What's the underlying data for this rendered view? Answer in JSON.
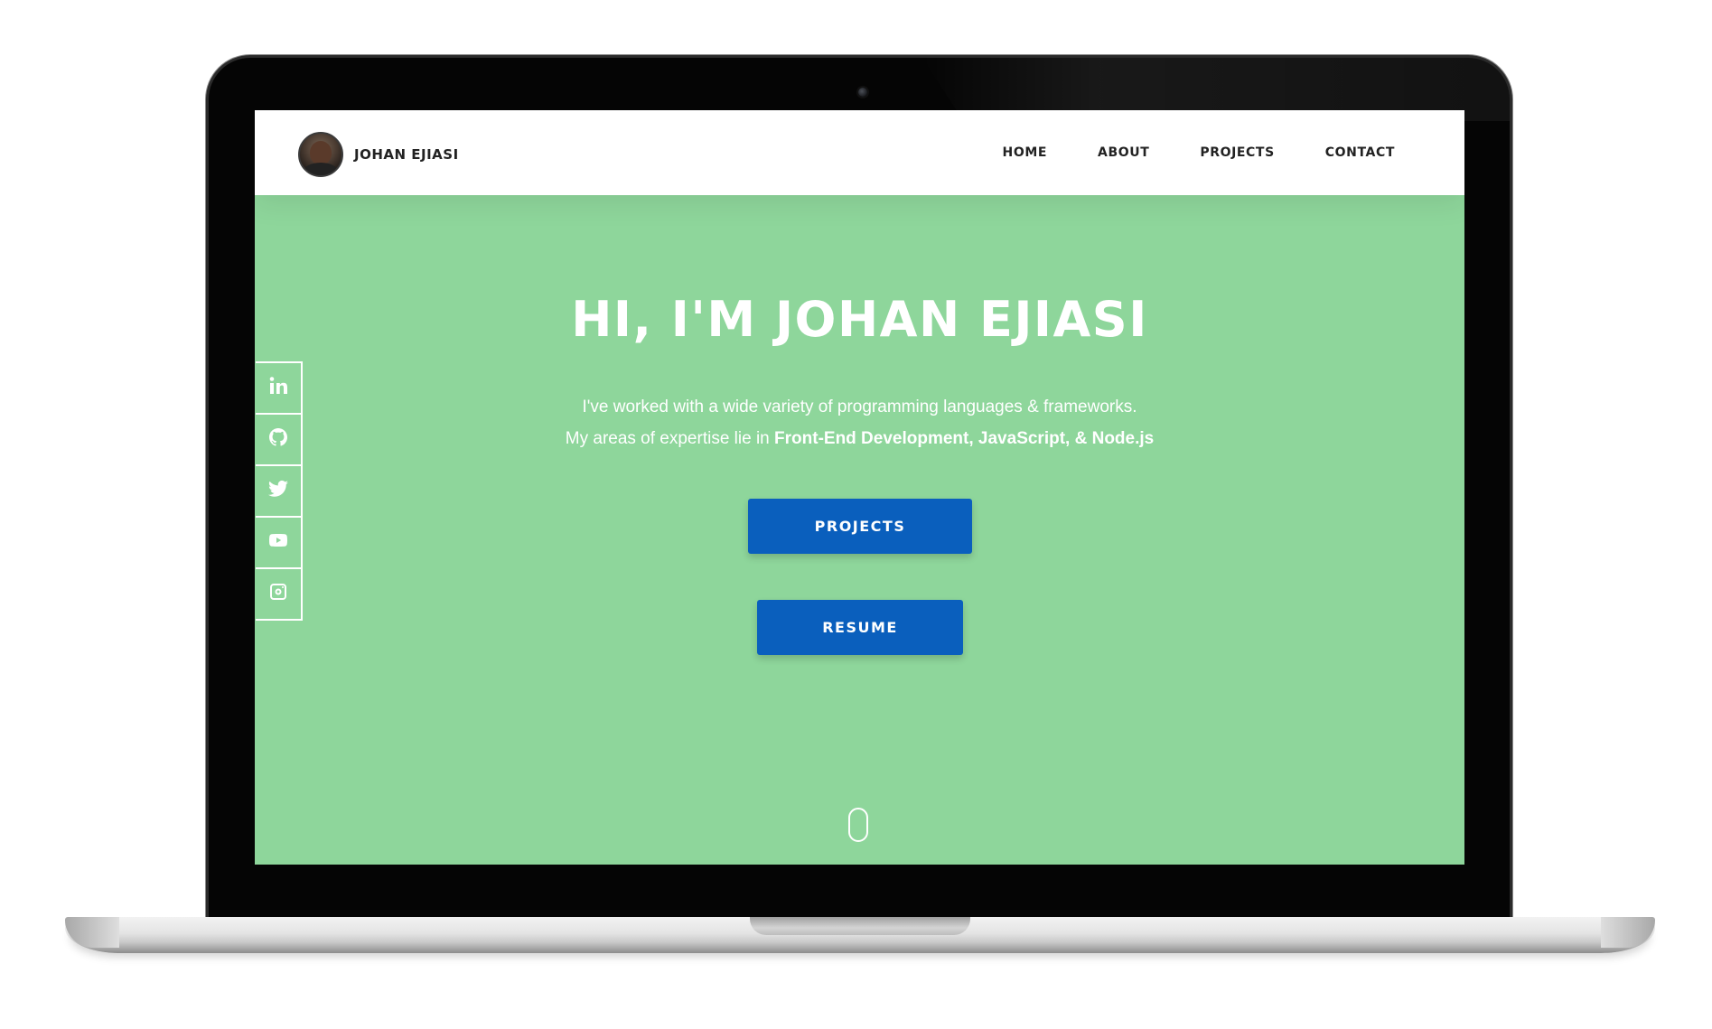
{
  "brand": {
    "name": "JOHAN EJIASI"
  },
  "nav": {
    "items": [
      {
        "label": "HOME"
      },
      {
        "label": "ABOUT"
      },
      {
        "label": "PROJECTS"
      },
      {
        "label": "CONTACT"
      }
    ]
  },
  "hero": {
    "title": "HI, I'M JOHAN EJIASI",
    "line1": "I've worked with a wide variety of programming languages & frameworks.",
    "line2_prefix": "My areas of expertise lie in ",
    "line2_bold": "Front-End Development, JavaScript, & Node.js"
  },
  "buttons": {
    "projects": "PROJECTS",
    "resume": "RESUME"
  },
  "social": {
    "icons": [
      "linkedin-icon",
      "github-icon",
      "twitter-icon",
      "youtube-icon",
      "instagram-icon"
    ]
  },
  "colors": {
    "hero_bg": "#8ed69b",
    "button_bg": "#0a5fbd",
    "navbar_bg": "#ffffff",
    "nav_text": "#222222"
  }
}
